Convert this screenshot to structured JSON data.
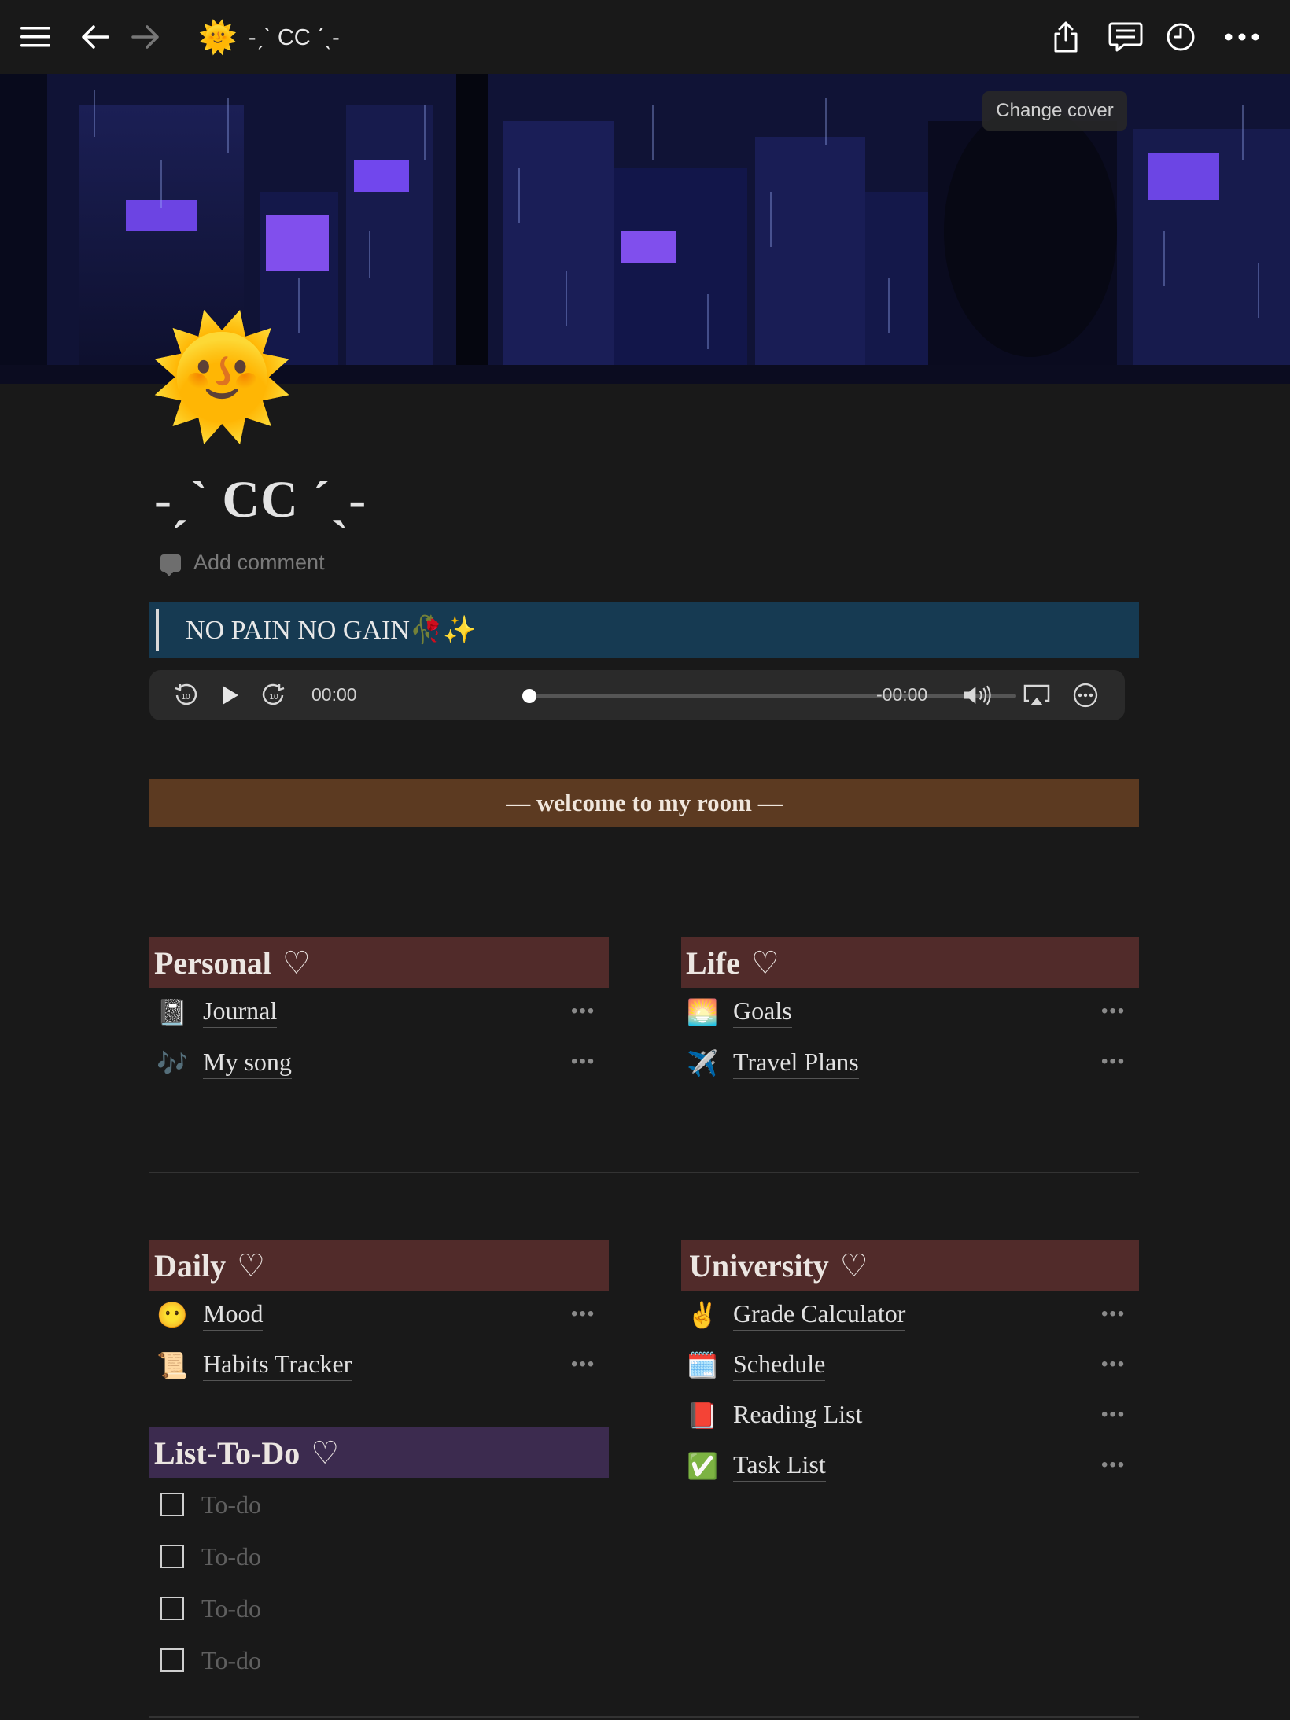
{
  "topbar": {
    "page_icon": "🌞",
    "page_title": "-ˏˋ CC ˊˎ-",
    "icons": [
      "menu-icon",
      "back-arrow-icon",
      "forward-arrow-icon",
      "share-icon",
      "comments-icon",
      "history-icon",
      "more-icon"
    ]
  },
  "cover": {
    "change_cover_label": "Change cover"
  },
  "page": {
    "icon": "🌞",
    "title": "-ˏˋ CC ˊˎ-",
    "add_comment": "Add comment"
  },
  "callout": {
    "text": "NO PAIN NO GAIN🥀✨"
  },
  "audio": {
    "current_time": "00:00",
    "remaining_time": "-00:00",
    "progress": 0
  },
  "banner": {
    "text": "— welcome to my room —"
  },
  "sections": {
    "personal": {
      "title": "Personal",
      "heart": "♡",
      "items": [
        {
          "emoji": "📓",
          "label": "Journal"
        },
        {
          "emoji": "🎶",
          "label": "My song"
        }
      ]
    },
    "life": {
      "title": "Life",
      "heart": "♡",
      "items": [
        {
          "emoji": "🌅",
          "label": "Goals"
        },
        {
          "emoji": "✈️",
          "label": "Travel Plans"
        }
      ]
    },
    "daily": {
      "title": "Daily",
      "heart": "♡",
      "items": [
        {
          "emoji": "😶",
          "label": "Mood"
        },
        {
          "emoji": "📜",
          "label": "Habits Tracker"
        }
      ]
    },
    "university": {
      "title": "University",
      "heart": "♡",
      "items": [
        {
          "emoji": "✌️",
          "label": "Grade Calculator"
        },
        {
          "emoji": "🗓️",
          "label": "Schedule"
        },
        {
          "emoji": "📕",
          "label": "Reading List"
        },
        {
          "emoji": "✅",
          "label": "Task List"
        }
      ]
    },
    "todo": {
      "title": "List-To-Do",
      "heart": "♡",
      "items": [
        {
          "label": "To-do",
          "checked": false
        },
        {
          "label": "To-do",
          "checked": false
        },
        {
          "label": "To-do",
          "checked": false
        },
        {
          "label": "To-do",
          "checked": false
        }
      ]
    }
  },
  "item_menu_glyph": "•••",
  "colors": {
    "background": "#191919",
    "callout_bg": "#163a52",
    "banner_bg": "#5c3a21",
    "section_red": "#512b2a",
    "section_purple": "#3c2b4f"
  }
}
